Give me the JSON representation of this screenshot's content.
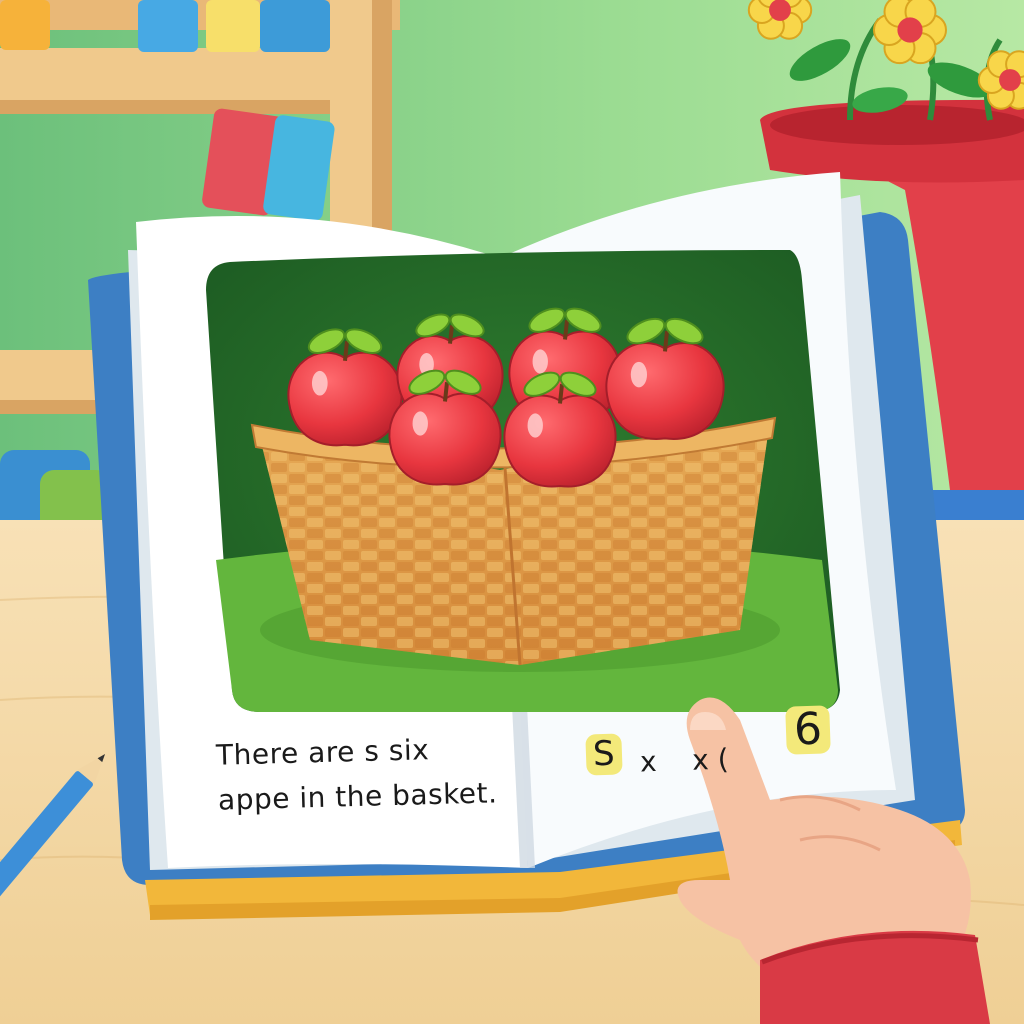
{
  "book": {
    "left_page": {
      "line1": "There are s six",
      "line2": "appe in the basket."
    },
    "right_page": {
      "highlight_s": "S",
      "middle_text": "x  x (",
      "highlight_6": "6"
    }
  },
  "illustration": {
    "apple_count": 6
  },
  "colors": {
    "wall_green": "#8fd58a",
    "desk": "#f3d9a6",
    "book_cover": "#3d7fc4",
    "apple_red": "#e8363f",
    "basket": "#e3a24c",
    "flower_pot": "#e2404a",
    "highlight": "#f3e97a"
  }
}
